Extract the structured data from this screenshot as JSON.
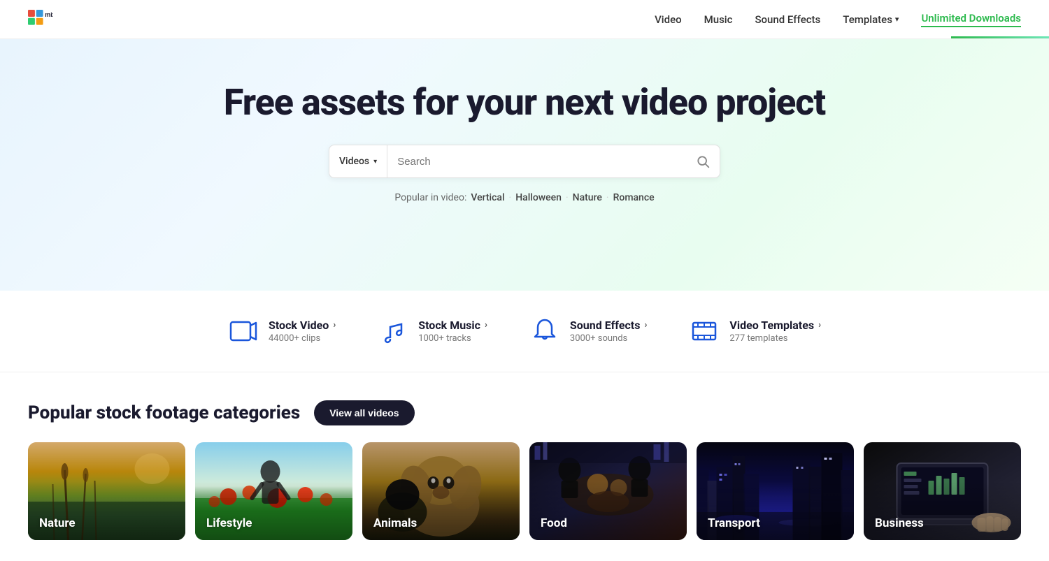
{
  "navbar": {
    "logo_alt": "Mixkit",
    "links": [
      {
        "label": "Video",
        "href": "#"
      },
      {
        "label": "Music",
        "href": "#"
      },
      {
        "label": "Sound Effects",
        "href": "#"
      },
      {
        "label": "Templates",
        "href": "#",
        "has_dropdown": true
      },
      {
        "label": "Unlimited Downloads",
        "href": "#",
        "accent": true
      }
    ]
  },
  "hero": {
    "headline": "Free assets for your next video project",
    "search": {
      "dropdown_label": "Videos",
      "placeholder": "Search"
    },
    "popular_label": "Popular in video:",
    "popular_tags": [
      "Vertical",
      "Halloween",
      "Nature",
      "Romance"
    ]
  },
  "features": [
    {
      "id": "stock-video",
      "icon": "video-icon",
      "title": "Stock Video",
      "count": "44000+ clips"
    },
    {
      "id": "stock-music",
      "icon": "music-icon",
      "title": "Stock Music",
      "count": "1000+ tracks"
    },
    {
      "id": "sound-effects",
      "icon": "bell-icon",
      "title": "Sound Effects",
      "count": "3000+ sounds"
    },
    {
      "id": "video-templates",
      "icon": "film-icon",
      "title": "Video Templates",
      "count": "277 templates"
    }
  ],
  "categories": {
    "section_title": "Popular stock footage categories",
    "view_all_label": "View all videos",
    "items": [
      {
        "id": "nature",
        "label": "Nature",
        "color_class": "cat-nature-scene"
      },
      {
        "id": "lifestyle",
        "label": "Lifestyle",
        "color_class": "cat-lifestyle-scene"
      },
      {
        "id": "animals",
        "label": "Animals",
        "color_class": "cat-animals-scene"
      },
      {
        "id": "food",
        "label": "Food",
        "color_class": "cat-food-scene"
      },
      {
        "id": "transport",
        "label": "Transport",
        "color_class": "cat-transport-scene"
      },
      {
        "id": "business",
        "label": "Business",
        "color_class": "cat-business-scene"
      }
    ]
  }
}
